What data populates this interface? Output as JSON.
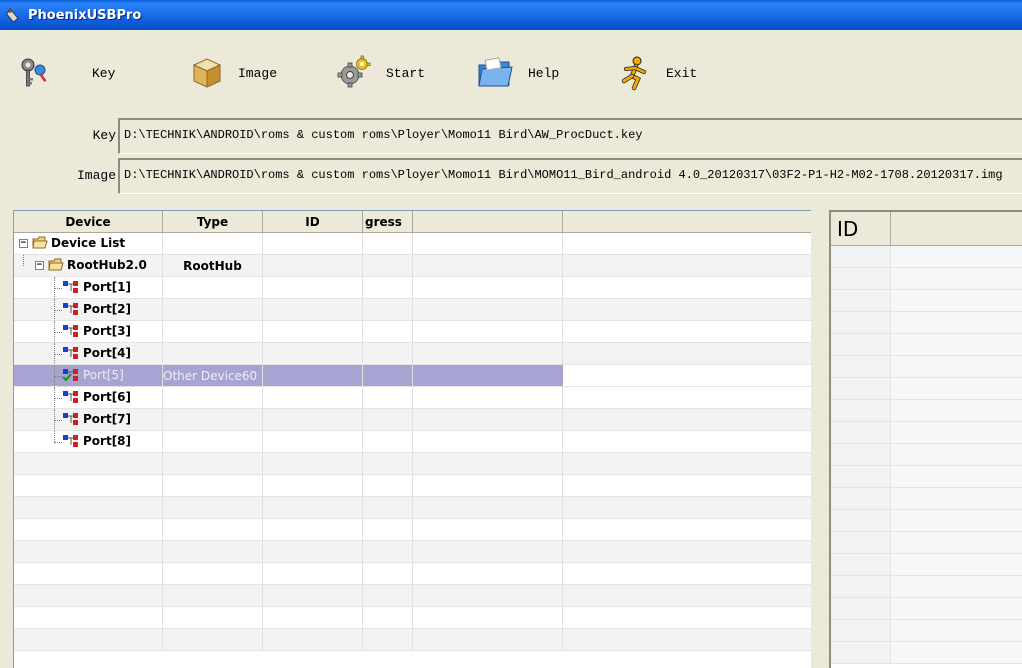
{
  "window": {
    "title": "PhoenixUSBPro"
  },
  "toolbar": {
    "key_label": "Key",
    "image_label": "Image",
    "start_label": "Start",
    "help_label": "Help",
    "exit_label": "Exit"
  },
  "paths": {
    "key_label": "Key",
    "key_value": "D:\\TECHNIK\\ANDROID\\roms & custom roms\\Ployer\\Momo11 Bird\\AW_ProcDuct.key",
    "image_label": "Image",
    "image_value": "D:\\TECHNIK\\ANDROID\\roms & custom roms\\Ployer\\Momo11 Bird\\MOMO11_Bird_android 4.0_20120317\\03F2-P1-H2-M02-1708.20120317.img"
  },
  "device_grid": {
    "columns": {
      "device": "Device",
      "type": "Type",
      "id": "ID",
      "progress": "gress"
    },
    "rows": [
      {
        "device": "Device List",
        "type": "",
        "level": 0
      },
      {
        "device": "RootHub2.0",
        "type": "RootHub",
        "level": 1
      },
      {
        "device": "Port[1]",
        "type": "",
        "level": 2
      },
      {
        "device": "Port[2]",
        "type": "",
        "level": 2
      },
      {
        "device": "Port[3]",
        "type": "",
        "level": 2
      },
      {
        "device": "Port[4]",
        "type": "",
        "level": 2
      },
      {
        "device": "Port[5]",
        "type": "Other Device60",
        "level": 2,
        "selected": true
      },
      {
        "device": "Port[6]",
        "type": "",
        "level": 2
      },
      {
        "device": "Port[7]",
        "type": "",
        "level": 2
      },
      {
        "device": "Port[8]",
        "type": "",
        "level": 2
      }
    ]
  },
  "right_panel": {
    "header_id": "ID"
  },
  "icons": {
    "app": "usb-stick-icon",
    "key": "keys-icon",
    "image": "box-icon",
    "start": "gears-icon",
    "help": "folder-help-icon",
    "exit": "running-man-icon",
    "folder": "folder-icon",
    "port": "usb-port-icon"
  }
}
